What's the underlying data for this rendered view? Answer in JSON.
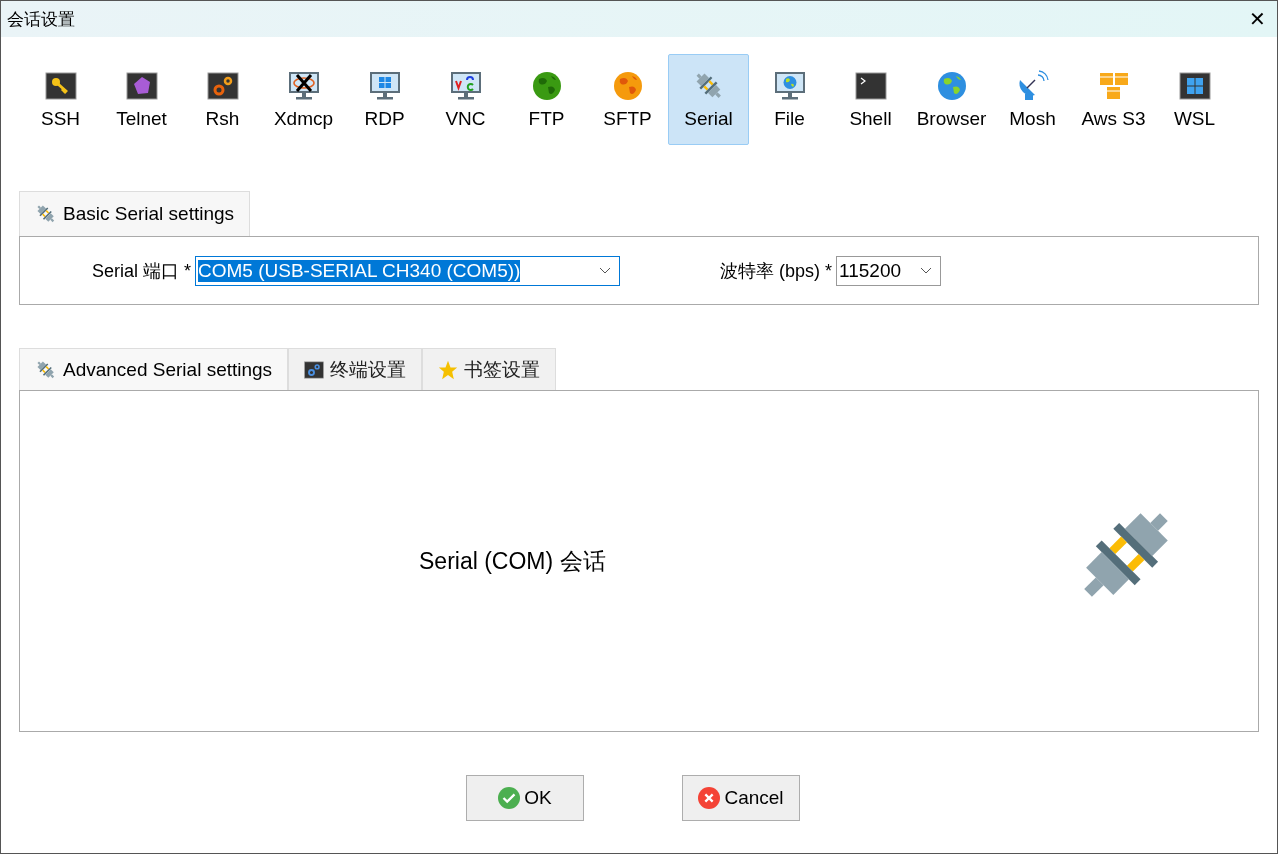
{
  "window": {
    "title": "会话设置",
    "close": "✕"
  },
  "session_types": [
    {
      "kind": "key",
      "label": "SSH",
      "selected": false
    },
    {
      "kind": "gem",
      "label": "Telnet",
      "selected": false
    },
    {
      "kind": "gears",
      "label": "Rsh",
      "selected": false
    },
    {
      "kind": "xmonitor",
      "label": "Xdmcp",
      "selected": false
    },
    {
      "kind": "winmonitor",
      "label": "RDP",
      "selected": false
    },
    {
      "kind": "vncmonitor",
      "label": "VNC",
      "selected": false
    },
    {
      "kind": "greenglobe",
      "label": "FTP",
      "selected": false
    },
    {
      "kind": "orangeglobe",
      "label": "SFTP",
      "selected": false
    },
    {
      "kind": "plug",
      "label": "Serial",
      "selected": true
    },
    {
      "kind": "globemonitor",
      "label": "File",
      "selected": false
    },
    {
      "kind": "terminal",
      "label": "Shell",
      "selected": false
    },
    {
      "kind": "globe",
      "label": "Browser",
      "selected": false
    },
    {
      "kind": "dish",
      "label": "Mosh",
      "selected": false
    },
    {
      "kind": "cubes",
      "label": "Aws S3",
      "selected": false
    },
    {
      "kind": "windows",
      "label": "WSL",
      "selected": false
    }
  ],
  "basic_tabs": [
    {
      "kind": "plug",
      "label": "Basic Serial settings",
      "selected": true
    }
  ],
  "basic": {
    "port_label": "Serial 端口 *",
    "port_value": "COM5  (USB-SERIAL CH340 (COM5))",
    "baud_label": "波特率 (bps) *",
    "baud_value": "115200"
  },
  "advanced_tabs": [
    {
      "kind": "plug",
      "label": "Advanced Serial settings",
      "selected": true
    },
    {
      "kind": "gears",
      "label": "终端设置",
      "selected": false
    },
    {
      "kind": "star",
      "label": "书签设置",
      "selected": false
    }
  ],
  "panel": {
    "caption": "Serial (COM) 会话"
  },
  "buttons": [
    {
      "kind": "ok",
      "label": "OK"
    },
    {
      "kind": "cancel",
      "label": "Cancel"
    }
  ]
}
